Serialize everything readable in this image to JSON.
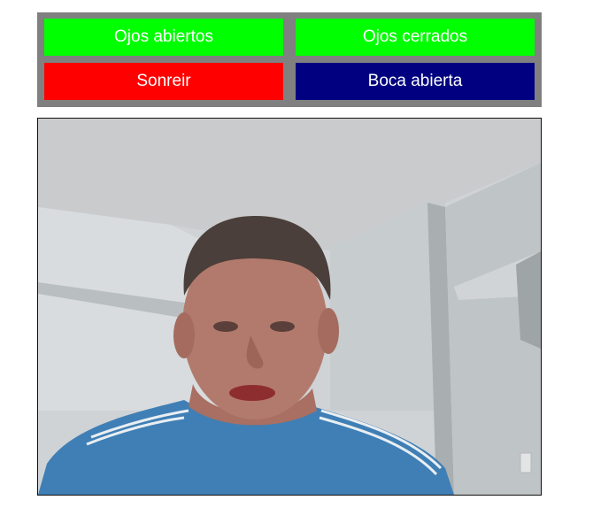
{
  "buttons": [
    {
      "label": "Ojos abiertos",
      "bg": "#00ff00",
      "fg": "#ffffff"
    },
    {
      "label": "Ojos cerrados",
      "bg": "#00ff00",
      "fg": "#ffffff"
    },
    {
      "label": "Sonreir",
      "bg": "#ff0000",
      "fg": "#ffffff"
    },
    {
      "label": "Boca abierta",
      "bg": "#000080",
      "fg": "#ffffff"
    }
  ],
  "colors": {
    "panel_bg": "#808080",
    "page_bg": "#ffffff"
  }
}
